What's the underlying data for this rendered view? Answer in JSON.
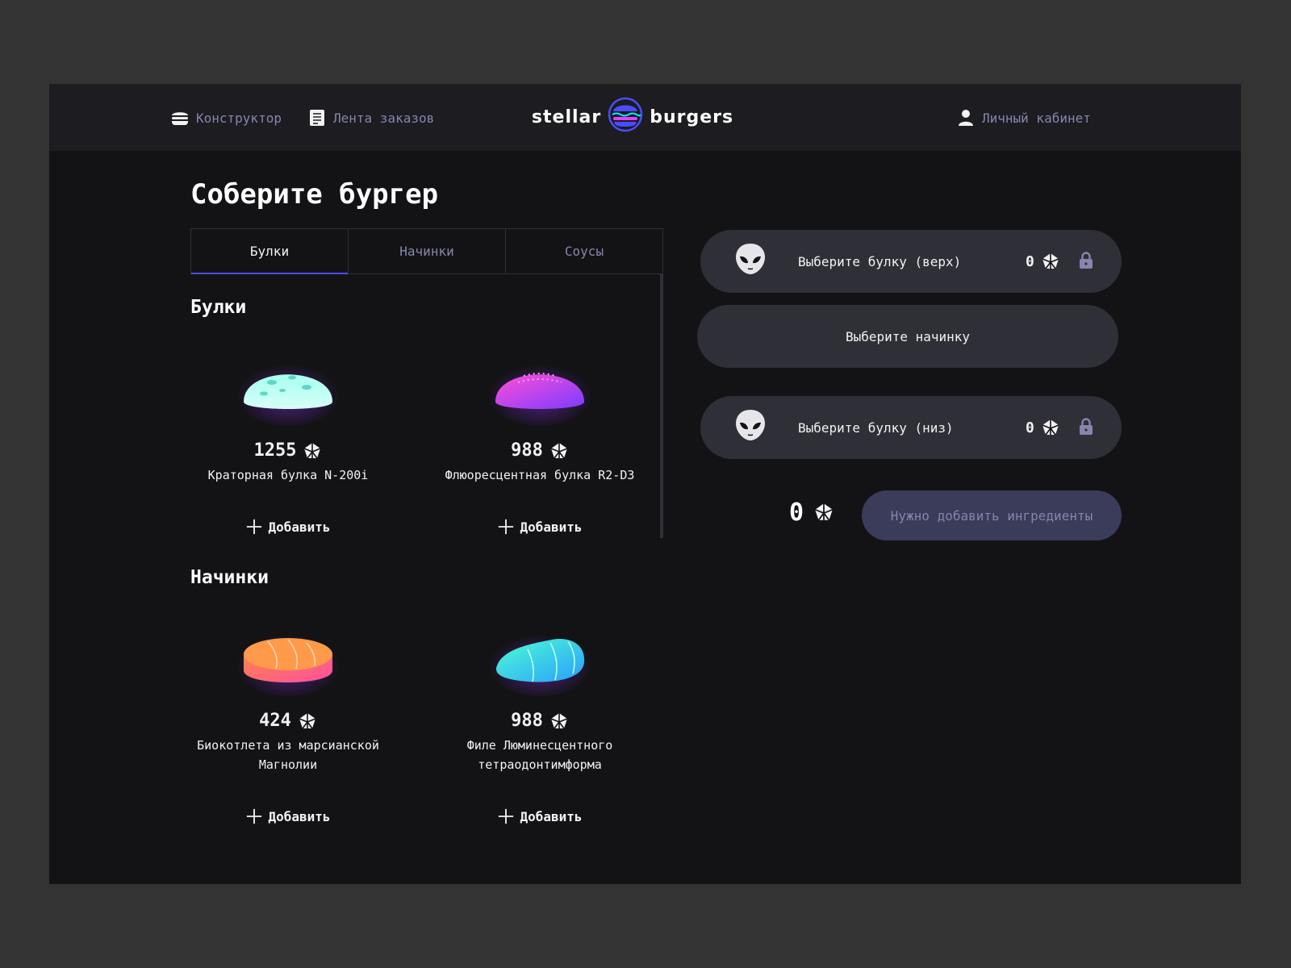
{
  "header": {
    "nav_constructor": "Конструктор",
    "nav_feed": "Лента заказов",
    "logo_left": "stellar",
    "logo_right": "burgers",
    "nav_profile": "Личный кабинет"
  },
  "main": {
    "title": "Соберите бургер",
    "tabs": [
      {
        "label": "Булки",
        "active": true
      },
      {
        "label": "Начинки",
        "active": false
      },
      {
        "label": "Соусы",
        "active": false
      }
    ],
    "sections": {
      "buns": {
        "title": "Булки",
        "items": [
          {
            "price": "1255",
            "name": "Краторная булка N-200i",
            "add": "Добавить",
            "icon": "crater-bun-image"
          },
          {
            "price": "988",
            "name": "Флюоресцентная булка R2-D3",
            "add": "Добавить",
            "icon": "fluorescent-bun-image"
          }
        ]
      },
      "fillings": {
        "title": "Начинки",
        "items": [
          {
            "price": "424",
            "name": "Биокотлета из марсианской Магнолии",
            "add": "Добавить",
            "icon": "bio-cutlet-image"
          },
          {
            "price": "988",
            "name": "Филе Люминесцентного тетраодонтимформа",
            "add": "Добавить",
            "icon": "luminescent-fillet-image"
          }
        ]
      }
    }
  },
  "constructor": {
    "top_bun": {
      "label": "Выберите булку (верх)",
      "price": "0"
    },
    "filling": {
      "label": "Выберите начинку"
    },
    "bottom_bun": {
      "label": "Выберите булку (низ)",
      "price": "0"
    },
    "total": "0",
    "order_button": "Нужно добавить ингредиенты"
  },
  "colors": {
    "accent": "#4c4cff",
    "background": "#131316",
    "header": "#1c1c21",
    "panel": "#2f2f37",
    "muted_text": "#8585ad"
  }
}
